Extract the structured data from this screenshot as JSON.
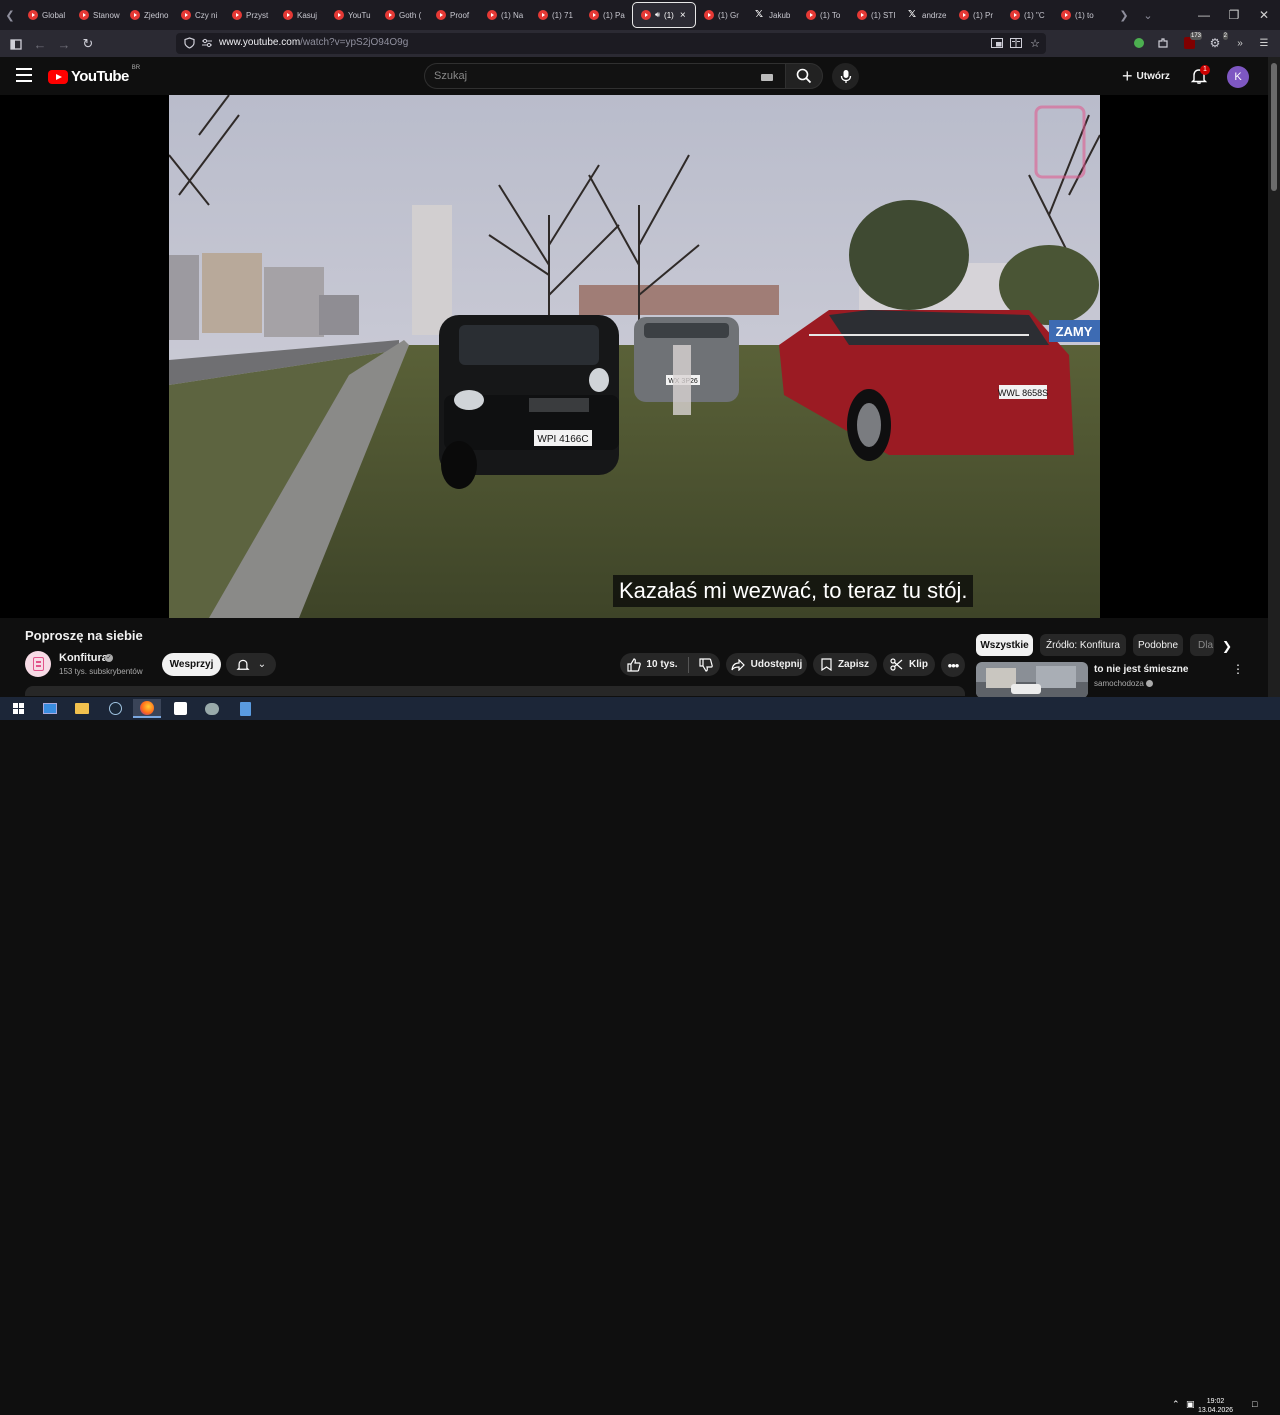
{
  "browser": {
    "tabs": [
      {
        "label": "Global",
        "icon": "youtube-icon"
      },
      {
        "label": "Stanow",
        "icon": "youtube-icon"
      },
      {
        "label": "Zjedno",
        "icon": "youtube-icon"
      },
      {
        "label": "Czy ni",
        "icon": "youtube-icon"
      },
      {
        "label": "Przyst",
        "icon": "youtube-icon"
      },
      {
        "label": "Kasuj",
        "icon": "youtube-icon"
      },
      {
        "label": "YouTu",
        "icon": "youtube-icon"
      },
      {
        "label": "Goth (",
        "icon": "youtube-icon"
      },
      {
        "label": "Proof",
        "icon": "youtube-icon"
      },
      {
        "label": "(1) Na",
        "icon": "youtube-icon"
      },
      {
        "label": "(1) 71",
        "icon": "youtube-icon"
      },
      {
        "label": "(1) Pa",
        "icon": "youtube-icon"
      },
      {
        "label": "(1)",
        "icon": "youtube-icon",
        "active": true
      },
      {
        "label": "(1) Gr",
        "icon": "youtube-icon"
      },
      {
        "label": "Jakub",
        "icon": "x-icon"
      },
      {
        "label": "(1) To",
        "icon": "youtube-icon"
      },
      {
        "label": "(1) STI",
        "icon": "youtube-icon"
      },
      {
        "label": "andrze",
        "icon": "x-icon"
      },
      {
        "label": "(1) Pr",
        "icon": "youtube-icon"
      },
      {
        "label": "(1) \"C",
        "icon": "youtube-icon"
      },
      {
        "label": "(1) to",
        "icon": "youtube-icon"
      }
    ],
    "url_host": "www.youtube.com",
    "url_path": "/watch?v=ypS2jO94O9g",
    "ext_badges": {
      "shield": "173",
      "puzzle": "2"
    }
  },
  "youtube": {
    "logo_text": "YouTube",
    "logo_country": "BR",
    "search_placeholder": "Szukaj",
    "create_label": "Utwórz",
    "notification_count": "1",
    "avatar_letter": "K"
  },
  "video": {
    "caption": "Kazałaś mi wezwać, to teraz tu stój.",
    "title": "Poproszę na siebie",
    "channel": "Konfitura",
    "subscribers": "153 tys. subskrybentów",
    "support_label": "Wesprzyj",
    "likes": "10 tys.",
    "share_label": "Udostępnij",
    "save_label": "Zapisz",
    "clip_label": "Klip",
    "plate_left": "WPI 4166C",
    "plate_right": "WWL 8658S",
    "plate_mid": "WX 3P26"
  },
  "sidebar": {
    "chips": [
      "Wszystkie",
      "Źródło: Konfitura",
      "Podobne",
      "Dla"
    ],
    "rec_title": "to nie jest śmieszne",
    "rec_channel": "samochodoza"
  },
  "taskbar": {
    "time": "19:02",
    "date": "13.04.2026"
  },
  "colors": {
    "youtube_red": "#ff0000",
    "avatar": "#7e57c2",
    "car_red": "#9b1b23"
  }
}
